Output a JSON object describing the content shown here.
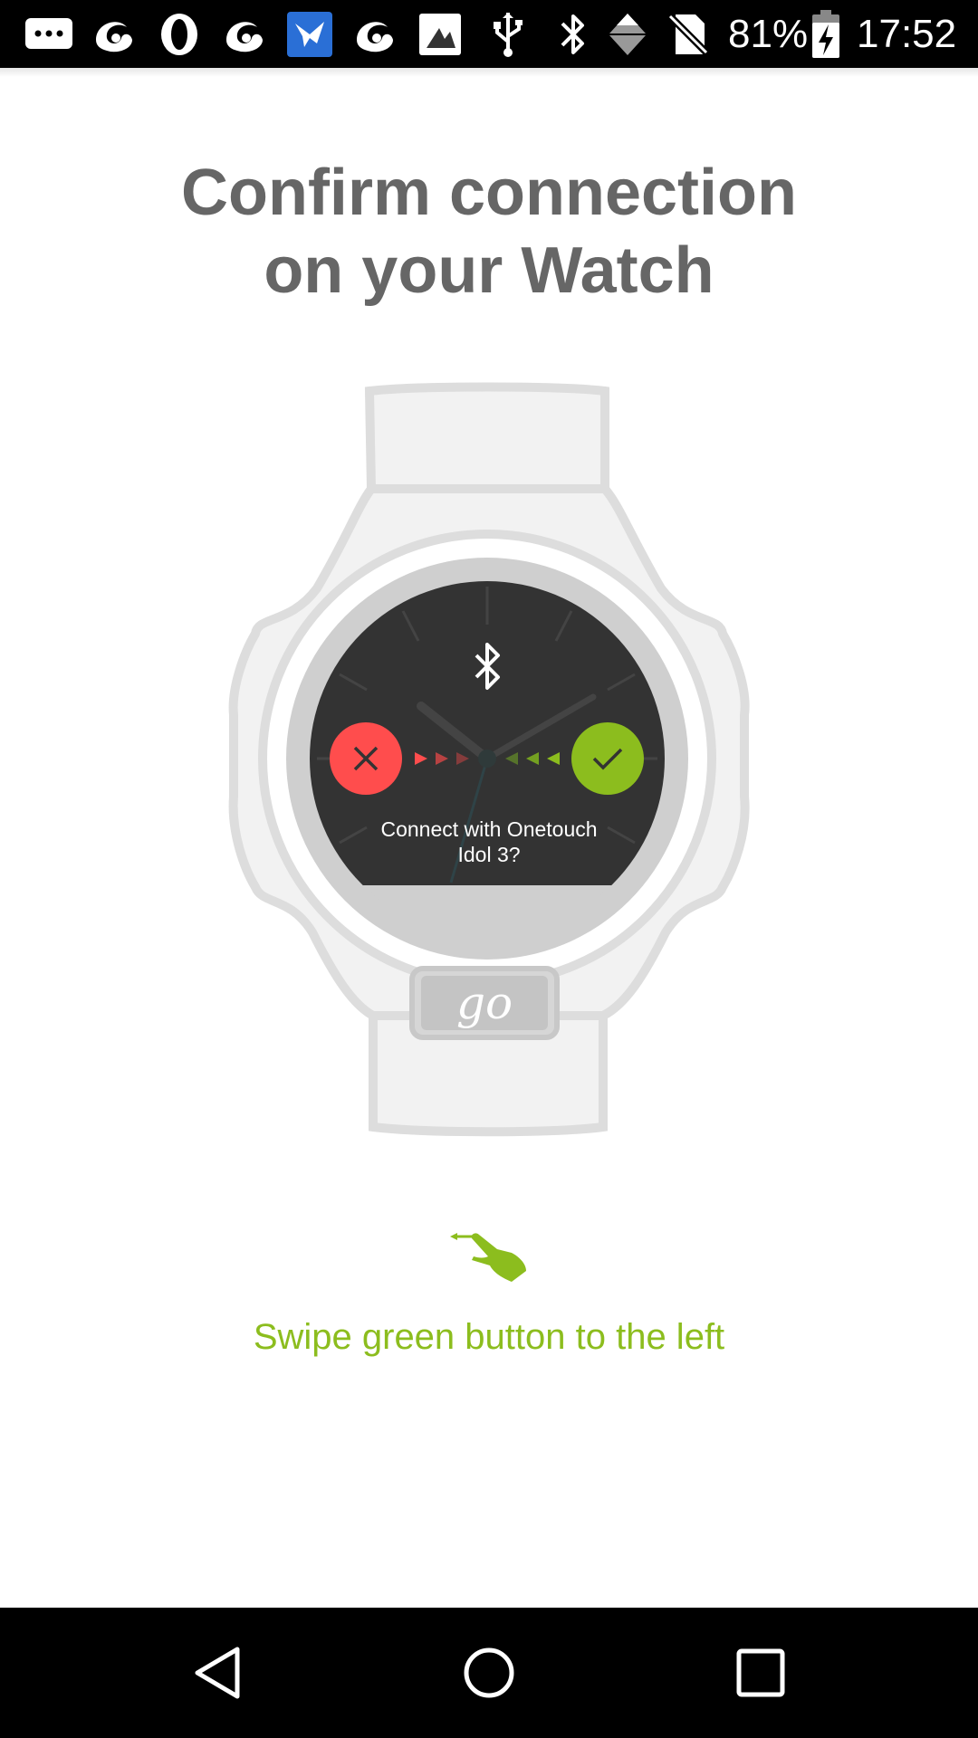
{
  "status_bar": {
    "battery_percent": "81%",
    "time": "17:52",
    "icons": [
      "messages-icon",
      "uc-browser-icon",
      "opera-icon",
      "uc-browser-icon",
      "bird-app-icon",
      "uc-browser-icon",
      "image-icon",
      "usb-icon",
      "bluetooth-icon",
      "data-icon",
      "no-sim-icon",
      "battery-charging-icon"
    ]
  },
  "header": {
    "title_line1": "Confirm connection",
    "title_line2": "on your Watch"
  },
  "watch": {
    "prompt_line1": "Connect with Onetouch",
    "prompt_line2": "Idol 3?",
    "logo_text": "go",
    "colors": {
      "decline": "#ff4d4d",
      "accept": "#8cbd1e",
      "face": "#333333",
      "strap": "#f2f2f2"
    }
  },
  "hint": {
    "text": "Swipe green button to the left",
    "color": "#8cbd1e"
  },
  "nav": {
    "icons": [
      "back-icon",
      "home-icon",
      "recents-icon"
    ]
  }
}
